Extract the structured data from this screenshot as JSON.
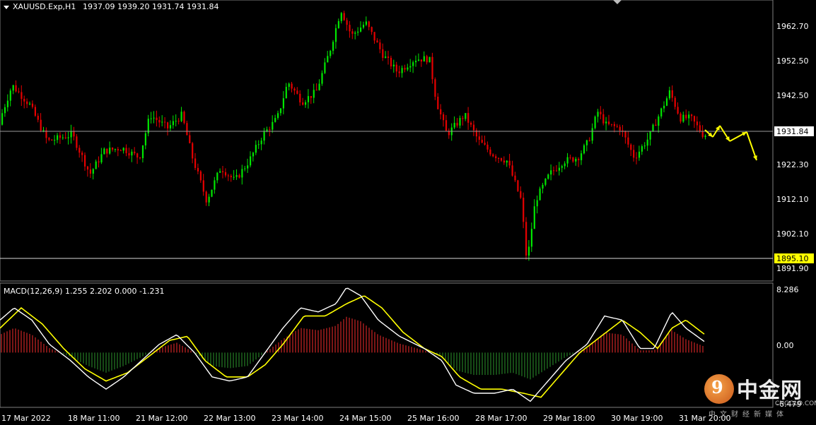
{
  "header": {
    "symbol": "XAUUSD.Exp,H1",
    "ohlc": "1937.09 1939.20 1931.74 1931.84"
  },
  "price_axis": {
    "ticks": [
      "1962.70",
      "1952.50",
      "1942.50",
      "1922.30",
      "1912.10",
      "1902.10",
      "1891.90"
    ],
    "current_price": "1931.84",
    "level_price": "1895.10"
  },
  "macd": {
    "label": "MACD(12,26,9) 1.255 2.202 0.000 -1.231",
    "ticks": [
      "8.286",
      "0.00",
      "-6.479"
    ]
  },
  "time_axis": {
    "labels": [
      "17 Mar 2022",
      "18 Mar 11:00",
      "21 Mar 12:00",
      "22 Mar 13:00",
      "23 Mar 14:00",
      "24 Mar 15:00",
      "25 Mar 16:00",
      "28 Mar 17:00",
      "29 Mar 18:00",
      "30 Mar 19:00",
      "31 Mar 20:00"
    ]
  },
  "watermark": {
    "glyph": "9",
    "name_cn": "中金网",
    "domain": "CNGOLD.COM.CN",
    "tagline": "中文财经新媒体"
  },
  "colors": {
    "bull_candle": "#00e600",
    "bear_candle": "#e60000",
    "macd_main": "#ffffff",
    "macd_signal": "#ffff00",
    "hist_positive": "#b02020",
    "hist_negative": "#1f6b1f",
    "forecast_arrow": "#ffff00",
    "level_label_bg": "#ffff00"
  },
  "chart_data": [
    {
      "type": "candlestick",
      "title": "XAUUSD.Exp,H1",
      "ylim": [
        1888,
        1972
      ],
      "key_levels": [
        1931.84,
        1895.1
      ],
      "price_path": [
        [
          0,
          1935
        ],
        [
          20,
          1947
        ],
        [
          45,
          1941
        ],
        [
          70,
          1930
        ],
        [
          105,
          1932
        ],
        [
          130,
          1920
        ],
        [
          150,
          1927
        ],
        [
          175,
          1928
        ],
        [
          200,
          1925
        ],
        [
          215,
          1938
        ],
        [
          240,
          1934
        ],
        [
          260,
          1938
        ],
        [
          275,
          1925
        ],
        [
          295,
          1912
        ],
        [
          315,
          1922
        ],
        [
          335,
          1918
        ],
        [
          355,
          1924
        ],
        [
          375,
          1932
        ],
        [
          395,
          1937
        ],
        [
          410,
          1948
        ],
        [
          430,
          1942
        ],
        [
          450,
          1945
        ],
        [
          470,
          1958
        ],
        [
          485,
          1970
        ],
        [
          500,
          1962
        ],
        [
          520,
          1966
        ],
        [
          545,
          1956
        ],
        [
          565,
          1951
        ],
        [
          590,
          1955
        ],
        [
          610,
          1955
        ],
        [
          620,
          1942
        ],
        [
          635,
          1932
        ],
        [
          660,
          1938
        ],
        [
          680,
          1930
        ],
        [
          700,
          1926
        ],
        [
          720,
          1924
        ],
        [
          740,
          1912
        ],
        [
          748,
          1893
        ],
        [
          760,
          1912
        ],
        [
          780,
          1920
        ],
        [
          800,
          1924
        ],
        [
          820,
          1925
        ],
        [
          835,
          1930
        ],
        [
          848,
          1939
        ],
        [
          860,
          1935
        ],
        [
          880,
          1934
        ],
        [
          900,
          1925
        ],
        [
          920,
          1931
        ],
        [
          935,
          1938
        ],
        [
          950,
          1945
        ],
        [
          965,
          1937
        ],
        [
          980,
          1937
        ],
        [
          997,
          1932
        ]
      ]
    },
    {
      "type": "line",
      "title": "MACD(12,26,9) 1.255 2.202 0.000 -1.231",
      "ylim": [
        -6.479,
        8.286
      ],
      "series": [
        {
          "name": "MACD",
          "values": [
            [
              0,
              4
            ],
            [
              20,
              5.5
            ],
            [
              45,
              4
            ],
            [
              70,
              1
            ],
            [
              100,
              -1
            ],
            [
              125,
              -3
            ],
            [
              150,
              -4.5
            ],
            [
              175,
              -3
            ],
            [
              200,
              -1
            ],
            [
              225,
              1
            ],
            [
              250,
              2.2
            ],
            [
              275,
              0
            ],
            [
              300,
              -3
            ],
            [
              325,
              -3.5
            ],
            [
              350,
              -3
            ],
            [
              375,
              0
            ],
            [
              400,
              3
            ],
            [
              425,
              5.5
            ],
            [
              450,
              5
            ],
            [
              475,
              6
            ],
            [
              490,
              8
            ],
            [
              510,
              7
            ],
            [
              535,
              4
            ],
            [
              565,
              2
            ],
            [
              600,
              0.5
            ],
            [
              625,
              -1
            ],
            [
              645,
              -4
            ],
            [
              670,
              -5
            ],
            [
              700,
              -5
            ],
            [
              725,
              -4.5
            ],
            [
              750,
              -6
            ],
            [
              770,
              -4
            ],
            [
              800,
              -1
            ],
            [
              830,
              1
            ],
            [
              855,
              4.5
            ],
            [
              880,
              4
            ],
            [
              905,
              0.5
            ],
            [
              925,
              0.5
            ],
            [
              950,
              5
            ],
            [
              970,
              3
            ],
            [
              997,
              1.3
            ]
          ]
        },
        {
          "name": "Signal",
          "values": [
            [
              0,
              3
            ],
            [
              30,
              5.5
            ],
            [
              60,
              3.5
            ],
            [
              90,
              0.5
            ],
            [
              120,
              -2
            ],
            [
              150,
              -3.5
            ],
            [
              180,
              -2.5
            ],
            [
              210,
              -0.5
            ],
            [
              240,
              1.5
            ],
            [
              265,
              2
            ],
            [
              290,
              -1
            ],
            [
              320,
              -3
            ],
            [
              350,
              -3
            ],
            [
              375,
              -1.5
            ],
            [
              400,
              1
            ],
            [
              430,
              4.5
            ],
            [
              460,
              4.5
            ],
            [
              490,
              6
            ],
            [
              515,
              7
            ],
            [
              540,
              5.5
            ],
            [
              570,
              2.5
            ],
            [
              600,
              0.5
            ],
            [
              625,
              -0.5
            ],
            [
              650,
              -3
            ],
            [
              680,
              -4.5
            ],
            [
              710,
              -4.5
            ],
            [
              740,
              -5
            ],
            [
              765,
              -5.5
            ],
            [
              790,
              -3
            ],
            [
              820,
              0
            ],
            [
              850,
              2
            ],
            [
              880,
              4
            ],
            [
              905,
              2.5
            ],
            [
              930,
              0.5
            ],
            [
              950,
              3
            ],
            [
              970,
              4
            ],
            [
              997,
              2.2
            ]
          ]
        }
      ]
    }
  ]
}
